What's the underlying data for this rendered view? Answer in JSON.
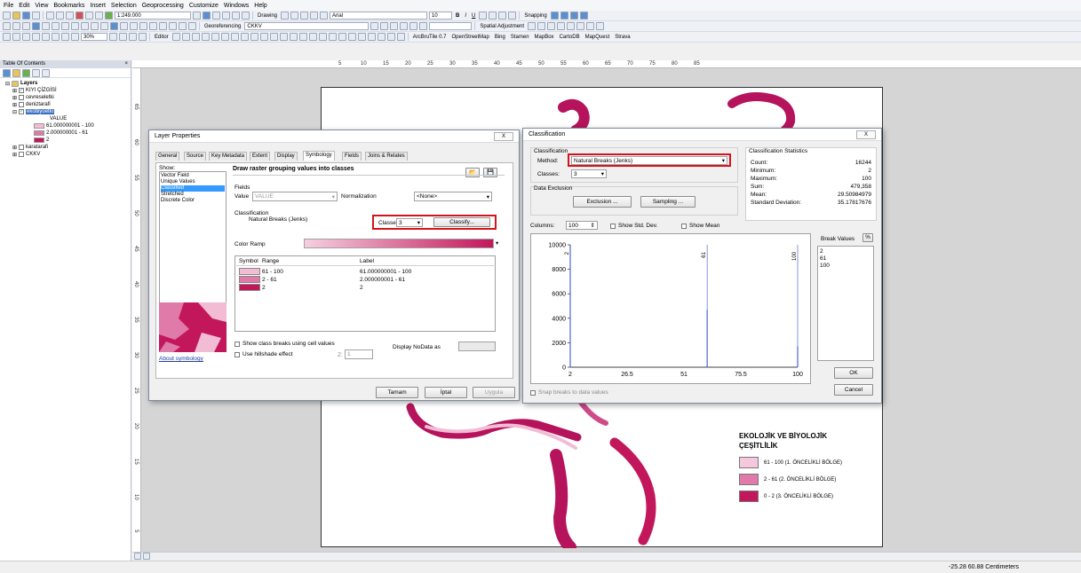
{
  "menu": [
    "File",
    "Edit",
    "View",
    "Bookmarks",
    "Insert",
    "Selection",
    "Geoprocessing",
    "Customize",
    "Windows",
    "Help"
  ],
  "toolbar": {
    "scale": "1:249.000",
    "drawing": "Drawing",
    "font": "Arial",
    "font_size": "10",
    "snapping": "Snapping",
    "georeferencing": "Georeferencing",
    "georef_layer": "CKKV",
    "spatial_adjustment": "Spatial Adjustment",
    "zoom": "30%",
    "editor": "Editor",
    "arcbru": "ArcBruTile 0.7",
    "openstreetmap": "OpenStreetMap",
    "bing": "Bing",
    "stamen": "Stamen",
    "mapbox": "MapBox",
    "cartodb": "CartoDB",
    "mapquest": "MapQuest",
    "strava": "Strava"
  },
  "toc": {
    "title": "Table Of Contents",
    "close": "p x",
    "root": "Layers",
    "layers": [
      "KIYI ÇİZGİSİ",
      "cevreseletki",
      "deniztarafi",
      "ekobiyoetki"
    ],
    "value_label": "VALUE",
    "classes": [
      "61.000000001 - 100",
      "2.000000001 - 61",
      "2"
    ],
    "class_colors": [
      "#f2bcd4",
      "#e07aa8",
      "#c2185b"
    ],
    "more_layers": [
      "karatarafi",
      "CKKV"
    ]
  },
  "ruler_h": [
    "5",
    "10",
    "15",
    "20",
    "25",
    "30",
    "35",
    "40",
    "45",
    "50",
    "55",
    "60",
    "65",
    "70",
    "75",
    "80",
    "85"
  ],
  "ruler_v": [
    "65",
    "60",
    "55",
    "50",
    "45",
    "40",
    "35",
    "30",
    "25",
    "20",
    "15",
    "10",
    "5"
  ],
  "layer_props": {
    "title": "Layer Properties",
    "close": "X",
    "tabs": [
      "General",
      "Source",
      "Key Metadata",
      "Extent",
      "Display",
      "Symbology",
      "Fields",
      "Joins & Relates"
    ],
    "show_label": "Show:",
    "show_items": [
      "Vector Field",
      "Unique Values",
      "Classified",
      "Stretched",
      "Discrete Color"
    ],
    "heading": "Draw raster grouping values into classes",
    "fields_label": "Fields",
    "value_label": "Value",
    "value_field": "VALUE",
    "normalization_label": "Normalization",
    "normalization_value": "<None>",
    "classification_label": "Classification",
    "method": "Natural Breaks (Jenks)",
    "classes_label": "Classes",
    "classes_value": "3",
    "classify_button": "Classify...",
    "color_ramp_label": "Color Ramp",
    "col_symbol": "Symbol",
    "col_range": "Range",
    "col_label": "Label",
    "rows": [
      {
        "range": "61 - 100",
        "label": "61.000000001 - 100",
        "color": "#f2bcd4"
      },
      {
        "range": "2 - 61",
        "label": "2.000000001 - 61",
        "color": "#e07aa8"
      },
      {
        "range": "2",
        "label": "2",
        "color": "#c2185b"
      }
    ],
    "show_breaks": "Show class breaks using cell values",
    "hillshade": "Use hillshade effect",
    "z_label": "Z:",
    "z_value": "1",
    "nodata_label": "Display NoData as",
    "about": "About symbology",
    "ok": "Tamam",
    "cancel": "İptal",
    "apply": "Uygula"
  },
  "classification": {
    "title": "Classification",
    "close": "X",
    "group_label": "Classification",
    "method_label": "Method:",
    "method_value": "Natural Breaks (Jenks)",
    "classes_label": "Classes:",
    "classes_value": "3",
    "data_exclusion": "Data Exclusion",
    "exclusion_button": "Exclusion ...",
    "sampling_button": "Sampling ...",
    "stats_title": "Classification Statistics",
    "stats": [
      {
        "k": "Count:",
        "v": "16244"
      },
      {
        "k": "Minimum:",
        "v": "2"
      },
      {
        "k": "Maximum:",
        "v": "100"
      },
      {
        "k": "Sum:",
        "v": "479,358"
      },
      {
        "k": "Mean:",
        "v": "29.50984979"
      },
      {
        "k": "Standard Deviation:",
        "v": "35.17817676"
      }
    ],
    "columns_label": "Columns:",
    "columns_value": "100",
    "show_std": "Show Std. Dev.",
    "show_mean": "Show Mean",
    "break_values_label": "Break Values",
    "pct": "%",
    "break_values": [
      "2",
      "61",
      "100"
    ],
    "snap_label": "Snap breaks to data values",
    "ok": "OK",
    "cancel": "Cancel"
  },
  "chart_data": {
    "type": "bar",
    "ylim": [
      0,
      10000
    ],
    "xlim": [
      2,
      100
    ],
    "yticks": [
      "10000",
      "8000",
      "6000",
      "4000",
      "2000",
      "0"
    ],
    "xticks": [
      "2",
      "26.5",
      "51",
      "75.5",
      "100"
    ],
    "breaks": [
      {
        "x": 2,
        "label": "2"
      },
      {
        "x": 61,
        "label": "61"
      },
      {
        "x": 100,
        "label": "100"
      }
    ],
    "bars": [
      {
        "x": 2,
        "y": 9800
      },
      {
        "x": 61,
        "y": 4700
      },
      {
        "x": 100,
        "y": 1700
      }
    ]
  },
  "legend": {
    "title_line1": "EKOLOJİK VE BİYOLOJİK",
    "title_line2": "ÇEŞİTLİLİK",
    "items": [
      {
        "label": "61 - 100 (1. ÖNCELİKLİ BÖLGE)",
        "color": "#f6c8dd"
      },
      {
        "label": "2 - 61 (2. ÖNCELİKLİ BÖLGE)",
        "color": "#e07aa8"
      },
      {
        "label": "0 - 2 (3. ÖNCELİKLİ BÖLGE)",
        "color": "#c2185b"
      }
    ]
  },
  "status": {
    "coords": "-25.28  60.88 Centimeters"
  }
}
